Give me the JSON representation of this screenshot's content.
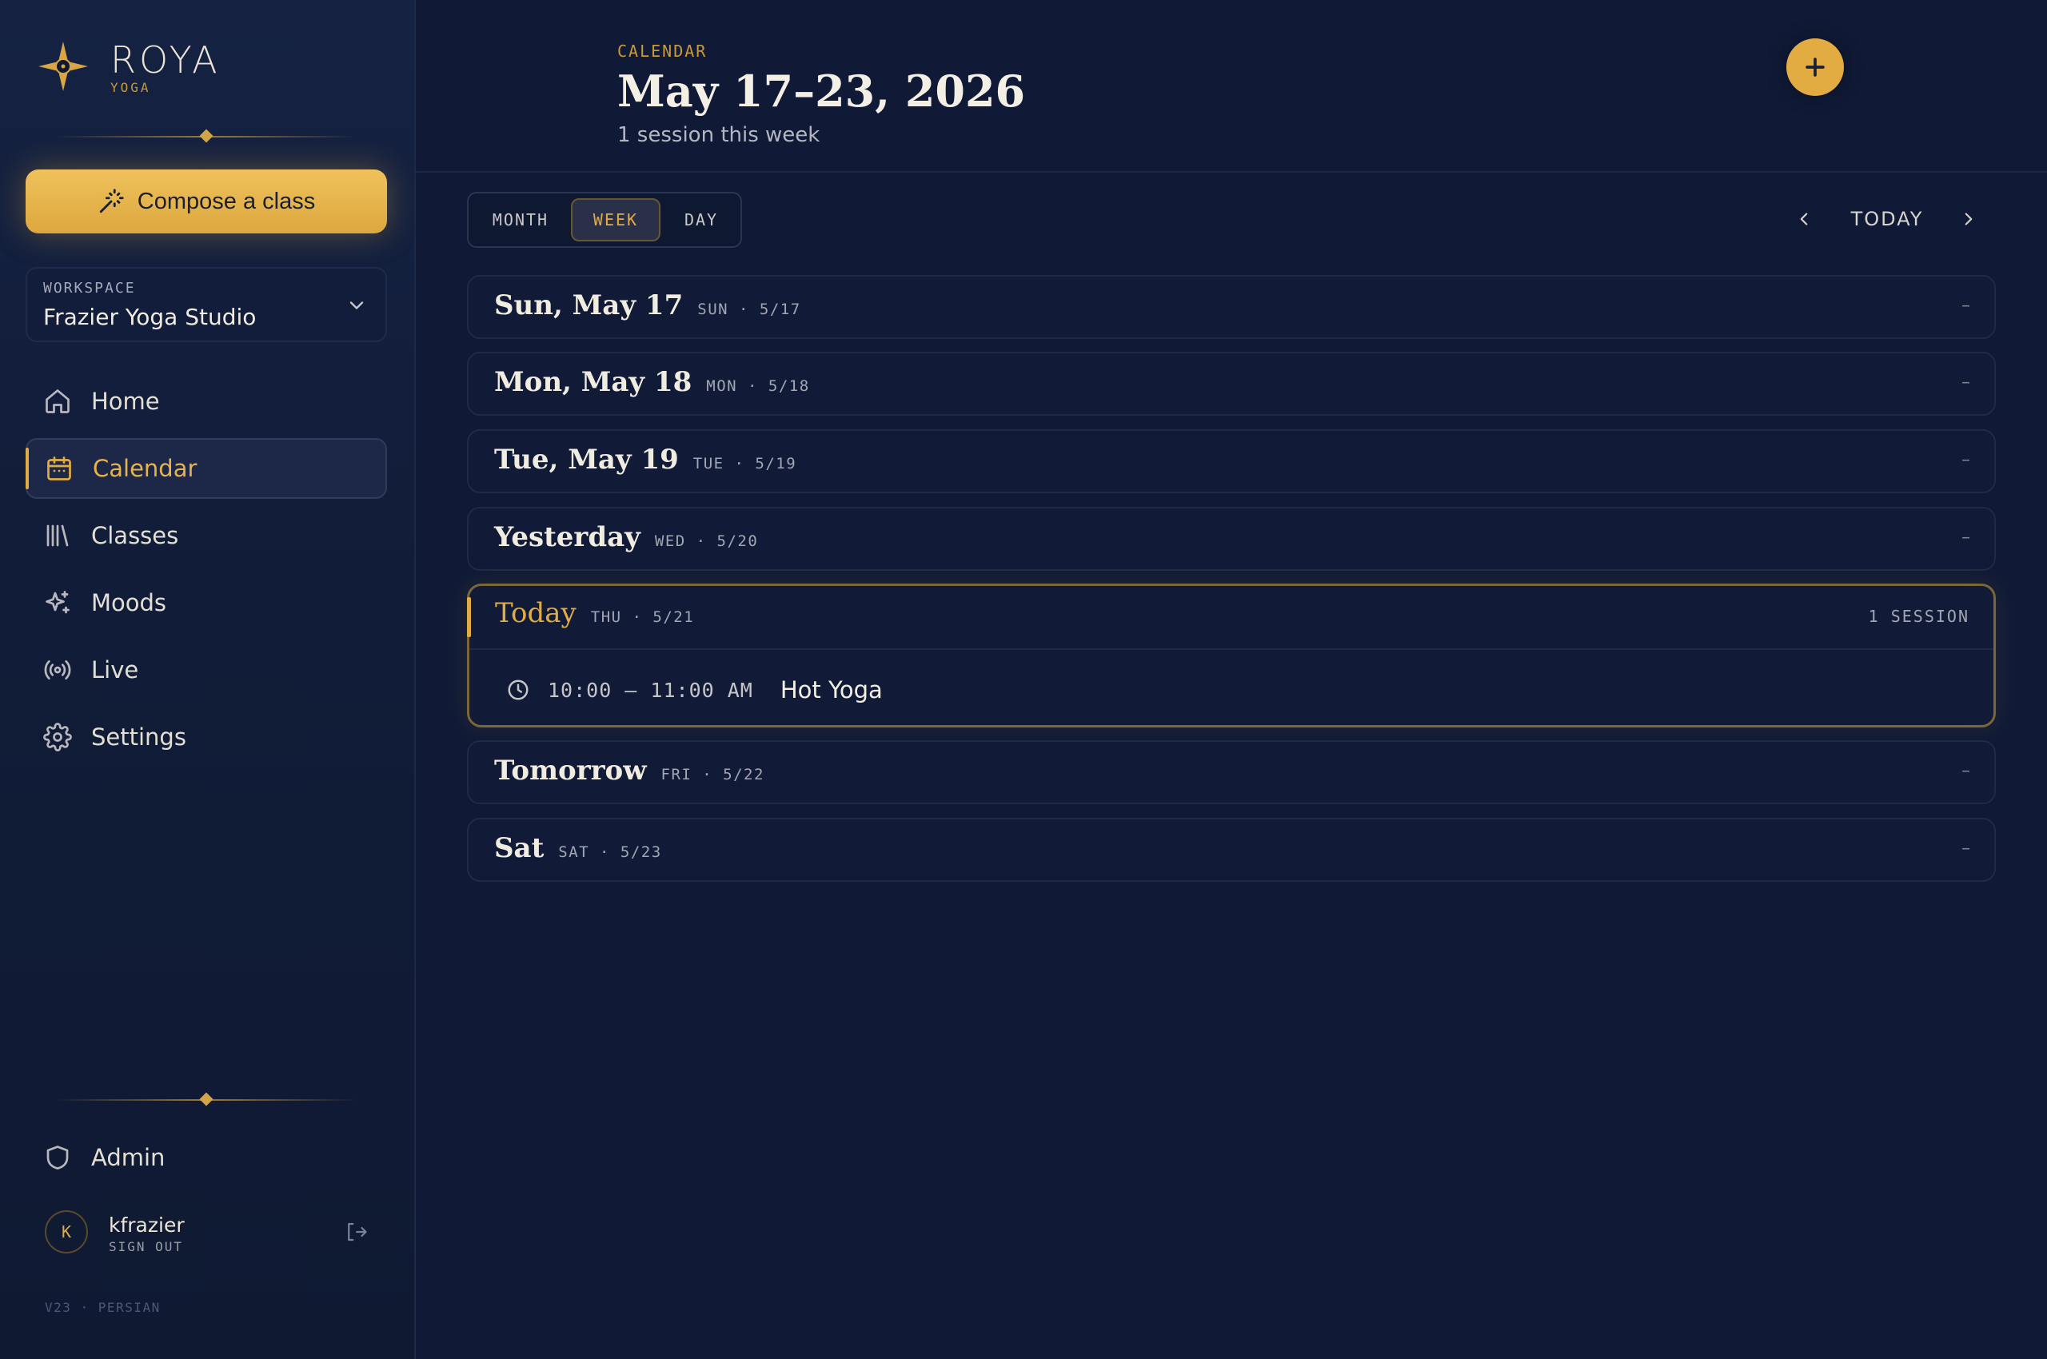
{
  "brand": {
    "name": "ROYA",
    "sub": "YOGA"
  },
  "sidebar": {
    "compose_label": "Compose a class",
    "workspace": {
      "label": "WORKSPACE",
      "name": "Frazier Yoga Studio"
    },
    "nav": [
      {
        "label": "Home",
        "icon": "home-icon"
      },
      {
        "label": "Calendar",
        "icon": "calendar-icon",
        "active": true
      },
      {
        "label": "Classes",
        "icon": "library-icon"
      },
      {
        "label": "Moods",
        "icon": "sparkles-icon"
      },
      {
        "label": "Live",
        "icon": "broadcast-icon"
      },
      {
        "label": "Settings",
        "icon": "gear-icon"
      }
    ],
    "admin_label": "Admin",
    "user": {
      "initial": "K",
      "name": "kfrazier",
      "signout": "SIGN OUT"
    },
    "version": "V23 · PERSIAN"
  },
  "header": {
    "eyebrow": "CALENDAR",
    "title": "May 17–23, 2026",
    "subtitle": "1 session this week"
  },
  "toolbar": {
    "views": [
      "MONTH",
      "WEEK",
      "DAY"
    ],
    "active_view": "WEEK",
    "today_label": "TODAY"
  },
  "days": [
    {
      "title": "Sun, May 17",
      "meta": "SUN · 5/17",
      "status": "–"
    },
    {
      "title": "Mon, May 18",
      "meta": "MON · 5/18",
      "status": "–"
    },
    {
      "title": "Tue, May 19",
      "meta": "TUE · 5/19",
      "status": "–"
    },
    {
      "title": "Yesterday",
      "meta": "WED · 5/20",
      "status": "–"
    },
    {
      "title": "Today",
      "meta": "THU · 5/21",
      "status": "1 SESSION"
    },
    {
      "title": "Tomorrow",
      "meta": "FRI · 5/22",
      "status": "–"
    },
    {
      "title": "Sat",
      "meta": "SAT · 5/23",
      "status": "–"
    }
  ],
  "today_session": {
    "time": "10:00 – 11:00 AM",
    "name": "Hot Yoga"
  },
  "colors": {
    "accent": "#e0ac45",
    "background": "#101a36",
    "sidebar": "#131f3e"
  }
}
